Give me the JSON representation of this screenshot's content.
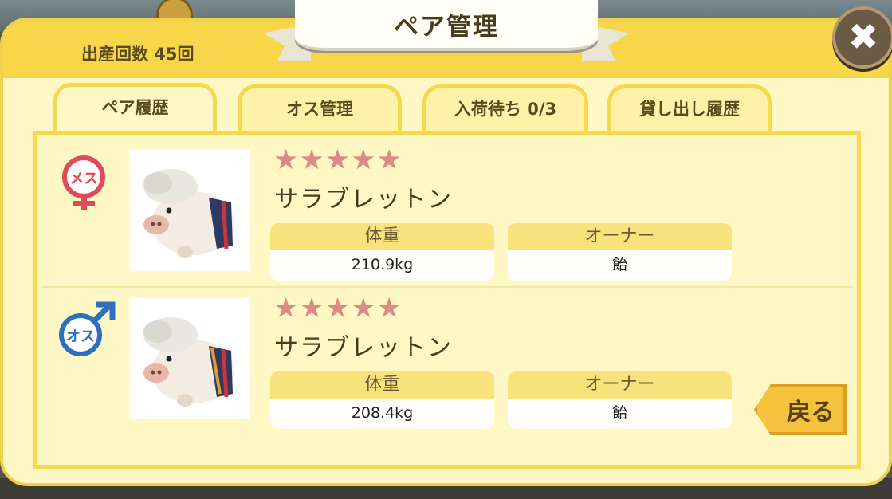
{
  "header": {
    "title": "ペア管理",
    "birth_count": "出産回数 45回",
    "close_label": "✖"
  },
  "tabs": [
    {
      "label": "ペア履歴",
      "active": true
    },
    {
      "label": "オス管理",
      "active": false
    },
    {
      "label": "入荷待ち 0/3",
      "active": false
    },
    {
      "label": "貸し出し履歴",
      "active": false
    }
  ],
  "pairs": [
    {
      "gender": "メス",
      "stars": "★★★★★",
      "name": "サラブレットン",
      "weight_label": "体重",
      "weight": "210.9kg",
      "owner_label": "オーナー",
      "owner": "飴"
    },
    {
      "gender": "オス",
      "stars": "★★★★★",
      "name": "サラブレットン",
      "weight_label": "体重",
      "weight": "208.4kg",
      "owner_label": "オーナー",
      "owner": "飴"
    }
  ],
  "back_label": "戻る",
  "colors": {
    "panel": "#fff7c4",
    "header": "#f7d64a",
    "star": "#dd8a84",
    "female": "#e04a5a",
    "male": "#2f6fbf"
  }
}
